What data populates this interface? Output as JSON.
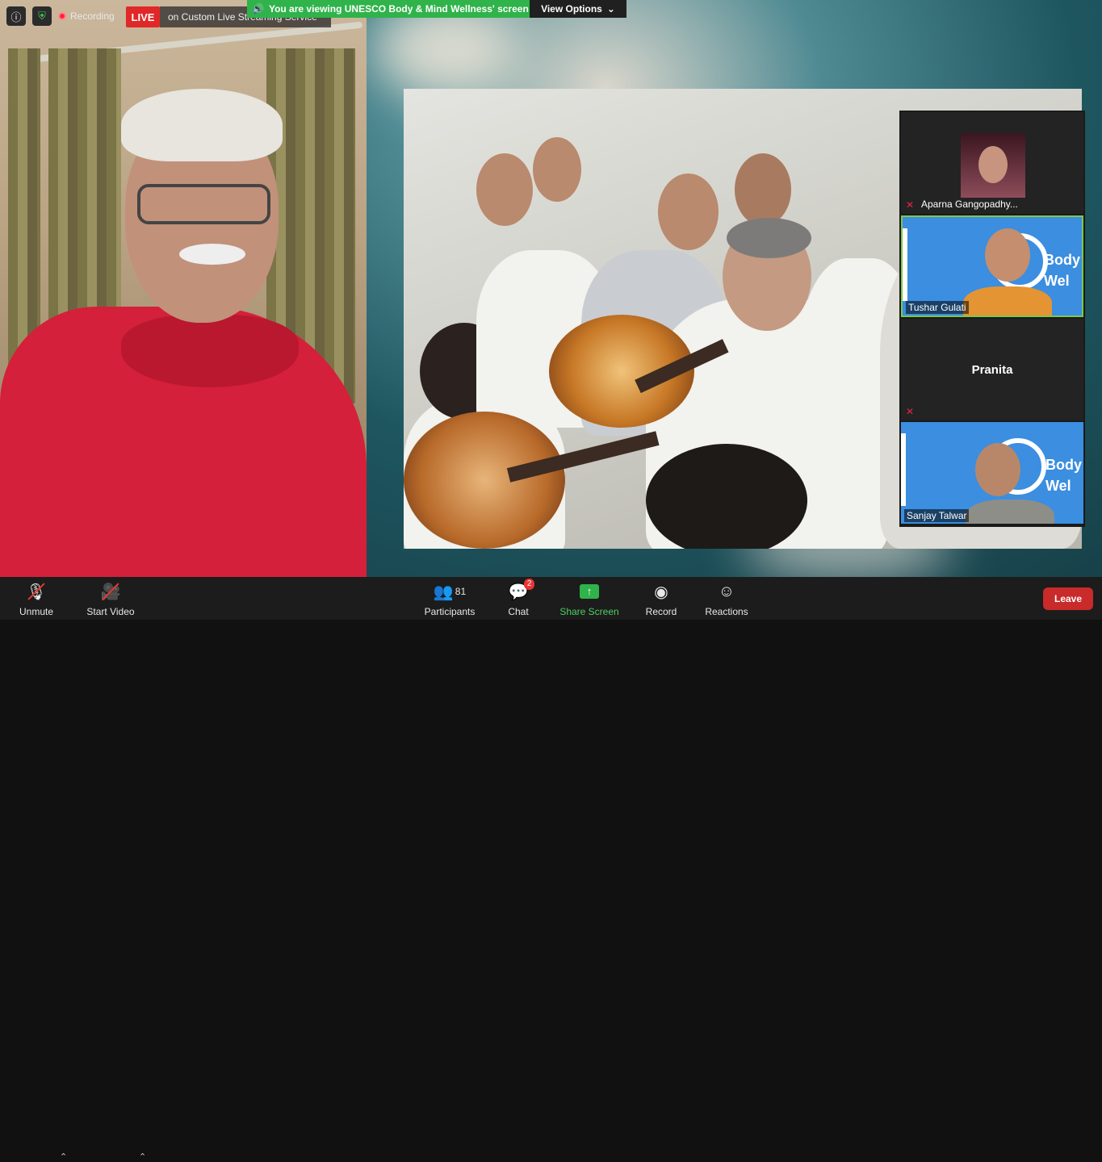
{
  "top_bar": {
    "recording_label": "Recording",
    "live_label": "LIVE",
    "live_service": "on Custom Live Streaming Service",
    "viewing_banner": "You are viewing UNESCO Body & Mind Wellness' screen",
    "view_options": "View Options"
  },
  "gallery": {
    "tiles": [
      {
        "name": "Aparna Gangopadhy...",
        "muted": true
      },
      {
        "name": "Tushar Gulati",
        "muted": false,
        "active": true
      },
      {
        "name": "Pranita",
        "muted": true
      },
      {
        "name": "Sanjay Talwar",
        "muted": false
      }
    ],
    "background_text_1": "Body",
    "background_text_2": "Wel"
  },
  "toolbar": {
    "unmute": "Unmute",
    "start_video": "Start Video",
    "participants": "Participants",
    "participants_count": "81",
    "chat": "Chat",
    "chat_badge": "2",
    "share_screen": "Share Screen",
    "record": "Record",
    "reactions": "Reactions",
    "leave": "Leave"
  },
  "icons": [
    "info-icon",
    "shield-icon",
    "record-dot-icon",
    "speaker-icon",
    "chevron-down-icon",
    "microphone-icon",
    "video-camera-icon",
    "participants-icon",
    "chat-icon",
    "share-screen-icon",
    "record-icon",
    "reactions-icon"
  ],
  "colors": {
    "live": "#e02828",
    "banner": "#2fb34a",
    "leave": "#c92a2a",
    "active_border": "#7cc84b"
  }
}
